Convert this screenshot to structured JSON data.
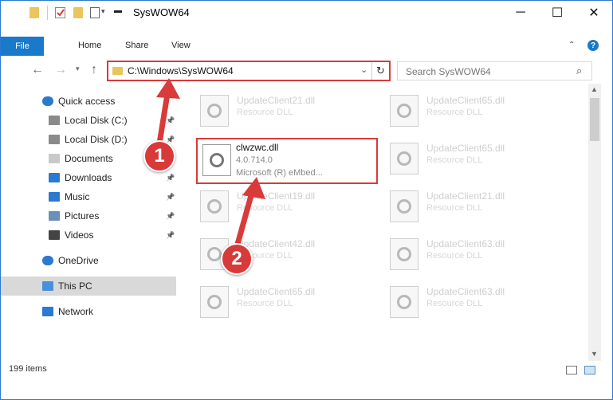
{
  "window": {
    "title": "SysWOW64"
  },
  "ribbon": {
    "tabs": [
      {
        "label": "File"
      },
      {
        "label": "Home"
      },
      {
        "label": "Share"
      },
      {
        "label": "View"
      }
    ]
  },
  "address_bar": {
    "path": "C:\\Windows\\SysWOW64"
  },
  "search": {
    "placeholder": "Search SysWOW64"
  },
  "nav_pane": {
    "items": [
      {
        "label": "Quick access",
        "icon": "star-icon"
      },
      {
        "label": "Local Disk (C:)",
        "icon": "drive-icon",
        "pinned": true
      },
      {
        "label": "Local Disk (D:)",
        "icon": "drive-icon",
        "pinned": true
      },
      {
        "label": "Documents",
        "icon": "documents-icon",
        "pinned": true
      },
      {
        "label": "Downloads",
        "icon": "download-icon",
        "pinned": true
      },
      {
        "label": "Music",
        "icon": "music-icon",
        "pinned": true
      },
      {
        "label": "Pictures",
        "icon": "pictures-icon",
        "pinned": true
      },
      {
        "label": "Videos",
        "icon": "videos-icon",
        "pinned": true
      },
      {
        "label": "OneDrive",
        "icon": "cloud-icon"
      },
      {
        "label": "This PC",
        "icon": "computer-icon",
        "selected": true
      },
      {
        "label": "Network",
        "icon": "network-icon"
      }
    ]
  },
  "files": {
    "left": [
      {
        "name": "UpdateClient21.dll",
        "desc": "Resource DLL"
      },
      {
        "name": "UpdateClient19.dll",
        "desc": "Resource DLL"
      },
      {
        "name": "UpdateClient42.dll",
        "desc": "Resource DLL"
      },
      {
        "name": "UpdateClient65.dll",
        "desc": "Resource DLL"
      }
    ],
    "right": [
      {
        "name": "UpdateClient65.dll",
        "desc": "Resource DLL"
      },
      {
        "name": "UpdateClient65.dll",
        "desc": "Resource DLL"
      },
      {
        "name": "UpdateClient21.dll",
        "desc": "Resource DLL"
      },
      {
        "name": "UpdateClient63.dll",
        "desc": "Resource DLL"
      },
      {
        "name": "UpdateClient63.dll",
        "desc": "Resource DLL"
      }
    ],
    "highlighted": {
      "name": "clwzwc.dll",
      "version": "4.0.714.0",
      "desc": "Microsoft (R) eMbed..."
    }
  },
  "status_bar": {
    "count": "199 items"
  },
  "markers": [
    "1",
    "2"
  ],
  "colors": {
    "accent": "#1979ca",
    "highlight": "#d93a3a"
  }
}
